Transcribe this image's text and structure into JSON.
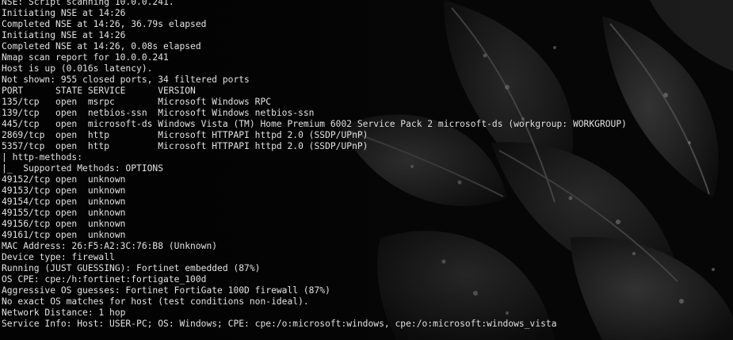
{
  "colors": {
    "background": "#040404",
    "text": "#e4e4e4"
  },
  "terminal": {
    "lines": [
      "NSE: Script scanning 10.0.0.241.",
      "Initiating NSE at 14:26",
      "Completed NSE at 14:26, 36.79s elapsed",
      "Initiating NSE at 14:26",
      "Completed NSE at 14:26, 0.08s elapsed",
      "Nmap scan report for 10.0.0.241",
      "Host is up (0.016s latency).",
      "Not shown: 955 closed ports, 34 filtered ports",
      "PORT      STATE SERVICE      VERSION",
      "135/tcp   open  msrpc        Microsoft Windows RPC",
      "139/tcp   open  netbios-ssn  Microsoft Windows netbios-ssn",
      "445/tcp   open  microsoft-ds Windows Vista (TM) Home Premium 6002 Service Pack 2 microsoft-ds (workgroup: WORKGROUP)",
      "2869/tcp  open  http         Microsoft HTTPAPI httpd 2.0 (SSDP/UPnP)",
      "5357/tcp  open  http         Microsoft HTTPAPI httpd 2.0 (SSDP/UPnP)",
      "| http-methods:",
      "|_  Supported Methods: OPTIONS",
      "49152/tcp open  unknown",
      "49153/tcp open  unknown",
      "49154/tcp open  unknown",
      "49155/tcp open  unknown",
      "49156/tcp open  unknown",
      "49161/tcp open  unknown",
      "MAC Address: 26:F5:A2:3C:76:B8 (Unknown)",
      "Device type: firewall",
      "Running (JUST GUESSING): Fortinet embedded (87%)",
      "OS CPE: cpe:/h:fortinet:fortigate_100d",
      "Aggressive OS guesses: Fortinet FortiGate 100D firewall (87%)",
      "No exact OS matches for host (test conditions non-ideal).",
      "Network Distance: 1 hop",
      "Service Info: Host: USER-PC; OS: Windows; CPE: cpe:/o:microsoft:windows, cpe:/o:microsoft:windows_vista"
    ]
  }
}
